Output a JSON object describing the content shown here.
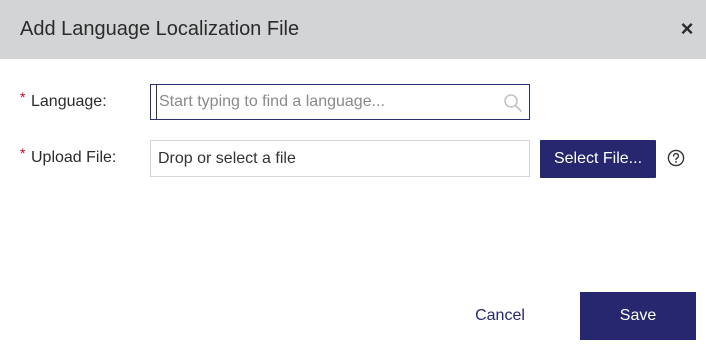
{
  "dialog": {
    "title": "Add Language Localization File",
    "close_symbol": "×"
  },
  "form": {
    "required_marker": "*",
    "language": {
      "label": "Language:",
      "placeholder": "Start typing to find a language...",
      "value": "",
      "icon": "search-icon"
    },
    "upload": {
      "label": "Upload File:",
      "drop_text": "Drop or select a file",
      "select_button": "Select File...",
      "help_icon": "help-circle-icon"
    }
  },
  "footer": {
    "cancel_label": "Cancel",
    "save_label": "Save"
  },
  "colors": {
    "header_bg": "#d3d4d6",
    "primary": "#26276e",
    "required": "#d0021b"
  }
}
